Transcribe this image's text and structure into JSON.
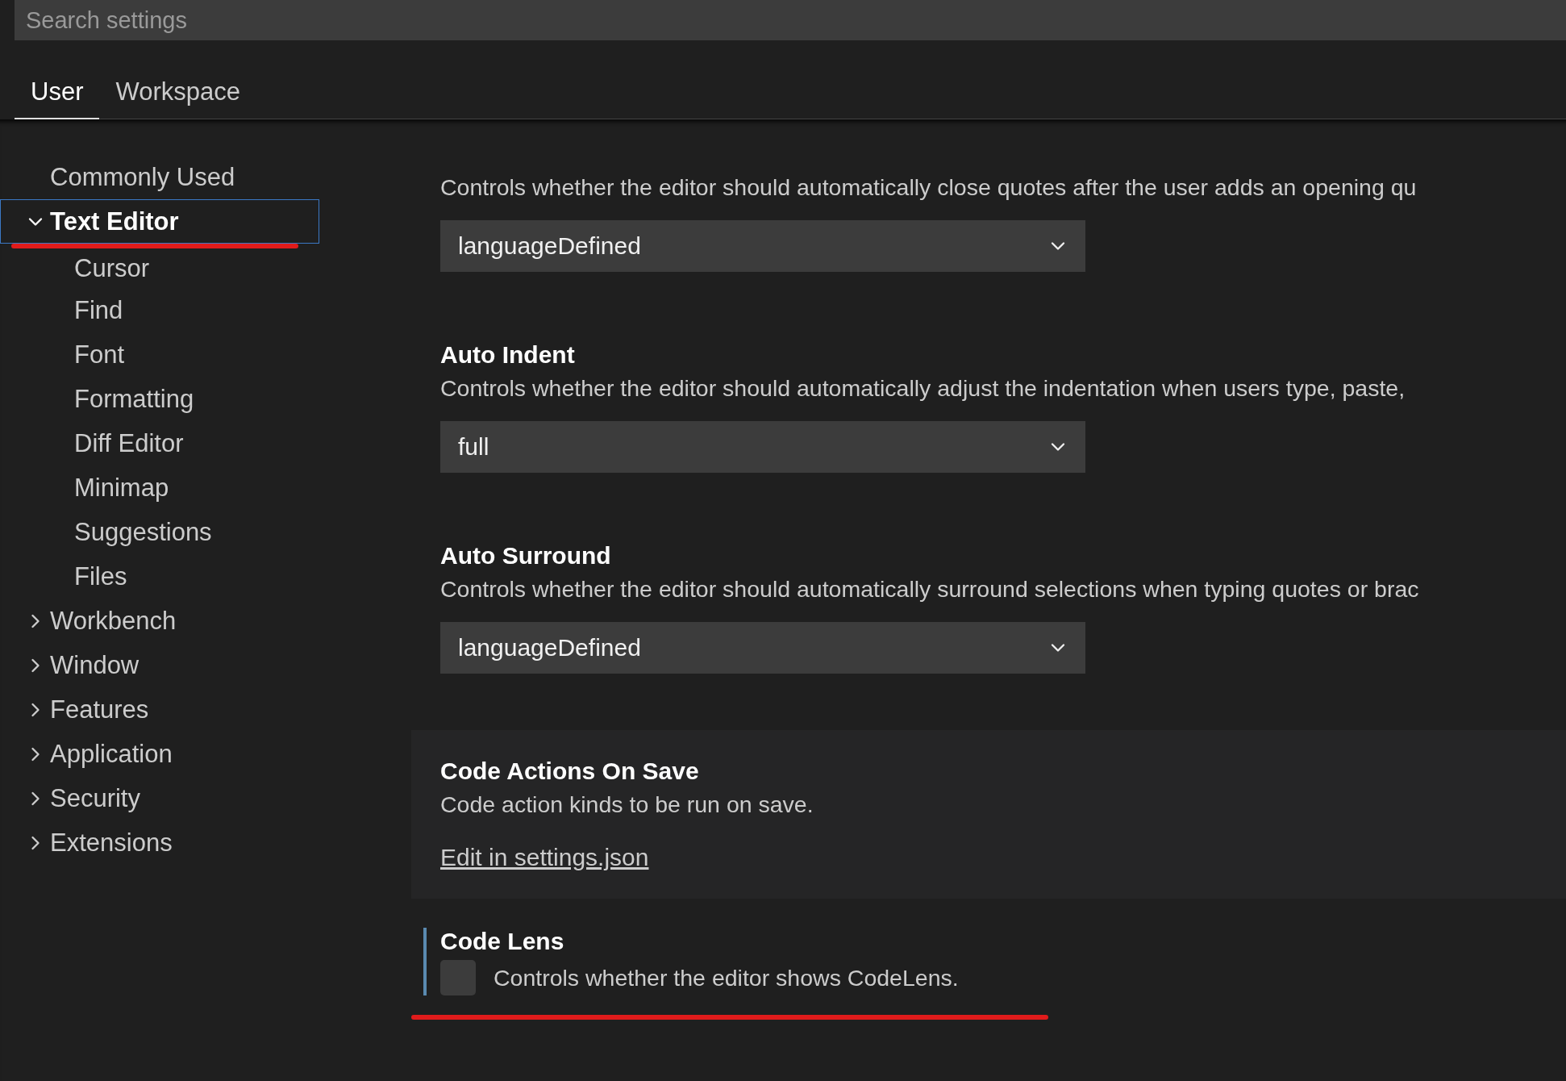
{
  "search": {
    "placeholder": "Search settings"
  },
  "tabs": [
    {
      "label": "User",
      "selected": true
    },
    {
      "label": "Workspace",
      "selected": false
    }
  ],
  "sidebar": {
    "items": [
      {
        "label": "Commonly Used",
        "selected": false
      },
      {
        "label": "Text Editor",
        "selected": true,
        "expanded": true,
        "children": [
          {
            "label": "Cursor"
          },
          {
            "label": "Find"
          },
          {
            "label": "Font"
          },
          {
            "label": "Formatting"
          },
          {
            "label": "Diff Editor"
          },
          {
            "label": "Minimap"
          },
          {
            "label": "Suggestions"
          },
          {
            "label": "Files"
          }
        ]
      },
      {
        "label": "Workbench",
        "selected": false,
        "expanded": false
      },
      {
        "label": "Window",
        "selected": false,
        "expanded": false
      },
      {
        "label": "Features",
        "selected": false,
        "expanded": false
      },
      {
        "label": "Application",
        "selected": false,
        "expanded": false
      },
      {
        "label": "Security",
        "selected": false,
        "expanded": false
      },
      {
        "label": "Extensions",
        "selected": false,
        "expanded": false
      }
    ]
  },
  "settings": [
    {
      "kind": "dropdown",
      "description": "Controls whether the editor should automatically close quotes after the user adds an opening qu",
      "value": "languageDefined"
    },
    {
      "kind": "dropdown",
      "title": "Auto Indent",
      "description": "Controls whether the editor should automatically adjust the indentation when users type, paste,",
      "value": "full"
    },
    {
      "kind": "dropdown",
      "title": "Auto Surround",
      "description": "Controls whether the editor should automatically surround selections when typing quotes or brac",
      "value": "languageDefined"
    },
    {
      "kind": "link",
      "title": "Code Actions On Save",
      "description": "Code action kinds to be run on save.",
      "link": "Edit in settings.json",
      "hovered": true
    },
    {
      "kind": "checkbox",
      "title": "Code Lens",
      "description": "Controls whether the editor shows CodeLens.",
      "checked": false,
      "focused": true
    }
  ]
}
